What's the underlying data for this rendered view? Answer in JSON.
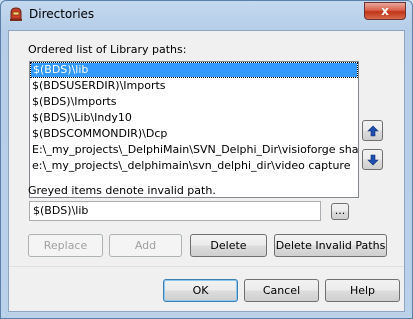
{
  "window": {
    "title": "Directories",
    "close_glyph": "x",
    "app_icon": "delphi-helmet-icon"
  },
  "list": {
    "label": "Ordered list of Library paths:",
    "items": [
      "$(BDS)\\lib",
      "$(BDSUSERDIR)\\Imports",
      "$(BDS)\\Imports",
      "$(BDS)\\Lib\\Indy10",
      "$(BDSCOMMONDIR)\\Dcp",
      "E:\\_my_projects\\_DelphiMain\\SVN_Delphi_Dir\\visioforge shared\\D",
      "e:\\_my_projects\\_delphimain\\svn_delphi_dir\\video capture"
    ],
    "selected_index": 0
  },
  "hint": "Greyed items denote invalid path.",
  "path_input": {
    "value": "$(BDS)\\lib"
  },
  "buttons": {
    "browse": "...",
    "replace": "Replace",
    "add": "Add",
    "delete": "Delete",
    "delete_invalid": "Delete Invalid Paths",
    "ok": "OK",
    "cancel": "Cancel",
    "help": "Help"
  },
  "icons": {
    "move_up": "arrow-up-icon",
    "move_down": "arrow-down-icon"
  },
  "colors": {
    "selection": "#3399ff",
    "arrow": "#1e4fb0",
    "close": "#c03418"
  }
}
